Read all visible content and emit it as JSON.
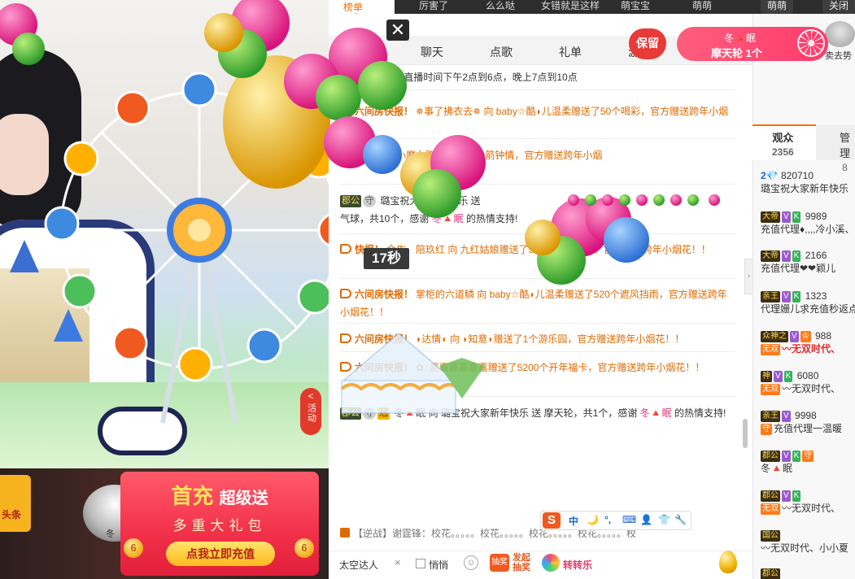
{
  "top": {
    "rank_label": "榜单",
    "ticker": [
      "厉害了",
      "么么哒",
      "女错就是这样",
      "萌宝宝",
      "萌萌"
    ],
    "right_pills": [
      "萌萌",
      "关闭"
    ]
  },
  "video": {
    "timer": "17秒",
    "activity_label": "活动",
    "activity_chevron": "<",
    "toutiao_label": "头条",
    "pedestal_label": "冬",
    "promo": {
      "title_big": "首充",
      "title_small": "超级送",
      "subtitle": "多重大礼包",
      "cta": "点我立即充值",
      "coin": "6"
    }
  },
  "chat": {
    "close_glyph": "✕",
    "tabs": [
      "聊天",
      "点歌",
      "礼单",
      "游"
    ],
    "keep_label": "保留",
    "gift_bubble": {
      "name": "冬🔺眠",
      "desc": "摩天轮 1个"
    },
    "messages": [
      {
        "lead": "代理充值",
        "text": "璐宝直播时间下午2点到6点，晚上7点到10点",
        "style": "plain"
      },
      {
        "lead": "六间房快报！",
        "text": "✵事了拂衣去✵ 向 baby☆酷◗儿温柔赠送了50个喝彩，官方赠送跨年小烟",
        "style": "orange"
      },
      {
        "lead": "快报！",
        "text": "熙小魔女赠送了10个一箭钟情，官方赠送跨年小烟",
        "style": "orange"
      },
      {
        "lead": "郡公",
        "text": "璐宝祝大家新年快乐 送",
        "tail": "气球，共10个，感谢",
        "thanks": "冬🔺眠",
        "end": "的热情支持!",
        "style": "gift"
      },
      {
        "lead": "快报！",
        "text": "余生、陪玖红 向 九红姑娘赠送了520个遮风挡雨，官方赠送跨年小烟花！！",
        "style": "orange"
      },
      {
        "lead": "六间房快报！",
        "text": "掌柜的六道鳞 向 baby☆酷◗儿温柔赠送了520个遮风挡雨，官方赠送跨年小烟花！！",
        "style": "orange"
      },
      {
        "lead": "六间房快报！",
        "text": "◗达情◗ 向 ◗知意◗赠送了1个游乐园，官方赠送跨年小烟花！！",
        "style": "orange"
      },
      {
        "lead": "六间房快报！",
        "text": "✿ .嘉嘉嘉嘉嘉嘉赠送了5200个开年福卡，官方赠送跨年小烟花！！",
        "style": "orange"
      },
      {
        "lead": "郡公",
        "text": "冬🔺眠 向 璐宝祝大家新年快乐 送",
        "tail": "摩天轮，共1个，感谢",
        "thanks": "冬🔺眠",
        "end": "的热情支持!",
        "style": "gift"
      }
    ],
    "bottom_ticker": "【逆战】谢霆锋：校花。。。。。校花。。。。。校花。。。。。校花。。。。。校",
    "ime": {
      "s": "S",
      "items": [
        "中",
        "🌙",
        "°,",
        "⌨",
        "👤",
        "👕",
        "🔧"
      ]
    },
    "input": {
      "target": "太空达人",
      "clear": "×",
      "whisper_label": "悄悄",
      "emoji": "☺",
      "lottery_icon": "抽奖",
      "lottery_label_1": "发起",
      "lottery_label_2": "抽奖",
      "zzl_label": "转转乐"
    }
  },
  "audience": {
    "tabs": [
      {
        "label": "观众",
        "count": "2356"
      },
      {
        "label": "管理",
        "count": "8"
      }
    ],
    "collapse": "›",
    "avatar_label": "卖去势",
    "items": [
      {
        "badge": "2💎",
        "name": "",
        "num": "820710",
        "line2": "璐宝祝大家新年快乐"
      },
      {
        "badge": "大帝",
        "name": "",
        "num": "9989",
        "line2": "充值代理♦,,,,冷小溪、"
      },
      {
        "badge": "大帝",
        "name": "",
        "num": "2166",
        "line2": "充值代理❤❤颖儿"
      },
      {
        "badge": "亲王",
        "name": "",
        "num": "1323",
        "line2": "代理姗儿求充值秒返点"
      },
      {
        "badge": "众神之",
        "name": "",
        "num": "988",
        "line2": "〰无双时代、",
        "wu": "无双"
      },
      {
        "badge": "神",
        "name": "",
        "num": "6080",
        "line2": "〰无双时代、",
        "wu": "无双"
      },
      {
        "badge": "亲王",
        "name": "",
        "num": "9998",
        "line2": "充值代理一温暖",
        "wu": "守"
      },
      {
        "badge": "郡公",
        "name": "",
        "num": "",
        "line2": "冬🔺眠"
      },
      {
        "badge": "郡公",
        "name": "",
        "num": "",
        "line2": "〰无双时代、",
        "wu": "无双"
      },
      {
        "badge": "国公",
        "name": "",
        "num": "",
        "line2": "〰无双时代、小小夏"
      },
      {
        "badge": "郡公",
        "name": "",
        "num": "",
        "line2": ""
      }
    ]
  },
  "colors": {
    "accent_orange": "#ff6c00",
    "promo_red": "#f2304a",
    "gift_pink": "#ff3b6c"
  }
}
